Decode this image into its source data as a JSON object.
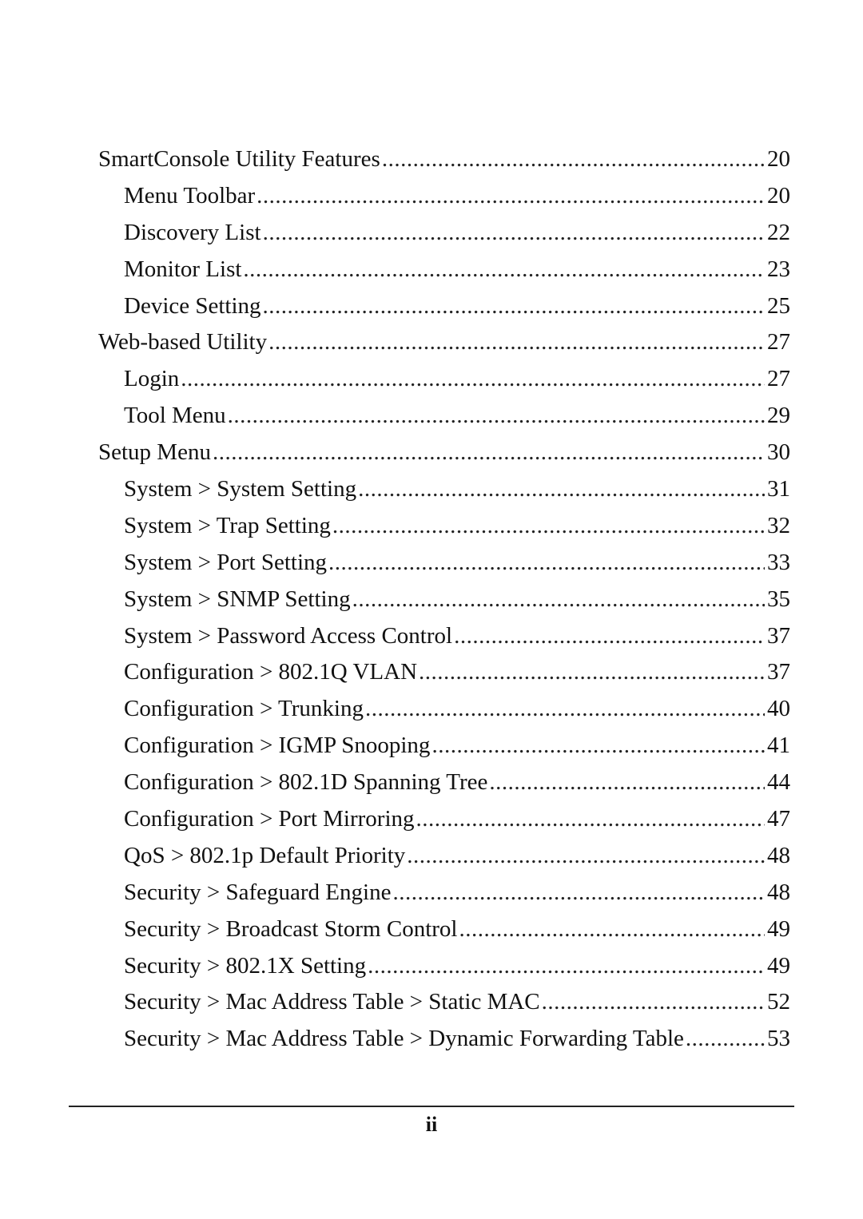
{
  "toc": {
    "entries": [
      {
        "title": "SmartConsole Utility Features",
        "page": "20",
        "level": 1
      },
      {
        "title": "Menu Toolbar",
        "page": "20",
        "level": 2
      },
      {
        "title": "Discovery List",
        "page": "22",
        "level": 2
      },
      {
        "title": "Monitor List",
        "page": "23",
        "level": 2
      },
      {
        "title": "Device Setting",
        "page": "25",
        "level": 2
      },
      {
        "title": "Web-based Utility",
        "page": "27",
        "level": 1
      },
      {
        "title": "Login",
        "page": "27",
        "level": 2
      },
      {
        "title": "Tool Menu",
        "page": "29",
        "level": 2
      },
      {
        "title": "Setup Menu",
        "page": "30",
        "level": 1
      },
      {
        "title": "System > System Setting",
        "page": "31",
        "level": 2
      },
      {
        "title": "System > Trap Setting",
        "page": "32",
        "level": 2
      },
      {
        "title": "System > Port Setting",
        "page": "33",
        "level": 2
      },
      {
        "title": "System > SNMP Setting",
        "page": "35",
        "level": 2
      },
      {
        "title": "System > Password Access Control",
        "page": "37",
        "level": 2
      },
      {
        "title": "Configuration > 802.1Q VLAN",
        "page": "37",
        "level": 2
      },
      {
        "title": "Configuration > Trunking",
        "page": "40",
        "level": 2
      },
      {
        "title": "Configuration > IGMP Snooping",
        "page": "41",
        "level": 2
      },
      {
        "title": "Configuration > 802.1D Spanning Tree",
        "page": "44",
        "level": 2
      },
      {
        "title": "Configuration > Port Mirroring",
        "page": "47",
        "level": 2
      },
      {
        "title": "QoS > 802.1p Default Priority",
        "page": "48",
        "level": 2
      },
      {
        "title": "Security > Safeguard Engine",
        "page": "48",
        "level": 2
      },
      {
        "title": "Security > Broadcast Storm Control",
        "page": "49",
        "level": 2
      },
      {
        "title": "Security > 802.1X Setting",
        "page": "49",
        "level": 2
      },
      {
        "title": "Security > Mac Address Table > Static MAC",
        "page": "52",
        "level": 2
      },
      {
        "title": "Security > Mac Address Table > Dynamic Forwarding Table",
        "page": "53",
        "level": 2
      }
    ]
  },
  "footer": {
    "page_number": "ii"
  }
}
